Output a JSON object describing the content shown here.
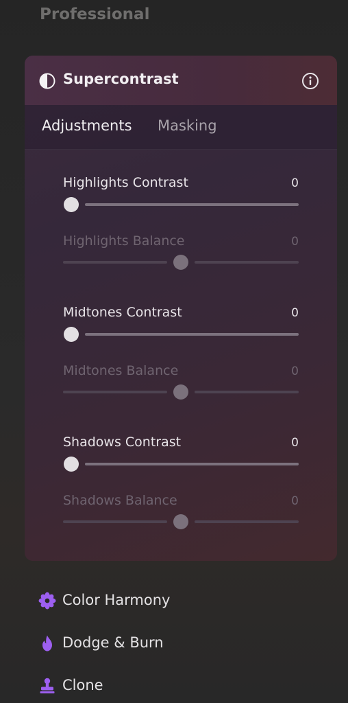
{
  "section": {
    "title": "Professional"
  },
  "panel": {
    "title": "Supercontrast",
    "tabs": [
      {
        "label": "Adjustments",
        "active": true
      },
      {
        "label": "Masking",
        "active": false
      }
    ],
    "sliders": [
      {
        "label": "Highlights Contrast",
        "value": "0",
        "enabled": true,
        "type": "contrast",
        "position": 0.0
      },
      {
        "label": "Highlights Balance",
        "value": "0",
        "enabled": false,
        "type": "balance",
        "position": 0.5
      },
      {
        "label": "Midtones Contrast",
        "value": "0",
        "enabled": true,
        "type": "contrast",
        "position": 0.0
      },
      {
        "label": "Midtones Balance",
        "value": "0",
        "enabled": false,
        "type": "balance",
        "position": 0.5
      },
      {
        "label": "Shadows Contrast",
        "value": "0",
        "enabled": true,
        "type": "contrast",
        "position": 0.0
      },
      {
        "label": "Shadows Balance",
        "value": "0",
        "enabled": false,
        "type": "balance",
        "position": 0.5
      }
    ]
  },
  "tools": [
    {
      "label": "Color Harmony",
      "icon": "flower-icon"
    },
    {
      "label": "Dodge & Burn",
      "icon": "flame-icon"
    },
    {
      "label": "Clone",
      "icon": "stamp-icon"
    }
  ],
  "colors": {
    "accent": "#9d5ff0",
    "panel_header": "#4a2f45",
    "text_primary": "#f2eff2",
    "text_disabled": "#6f6470"
  }
}
